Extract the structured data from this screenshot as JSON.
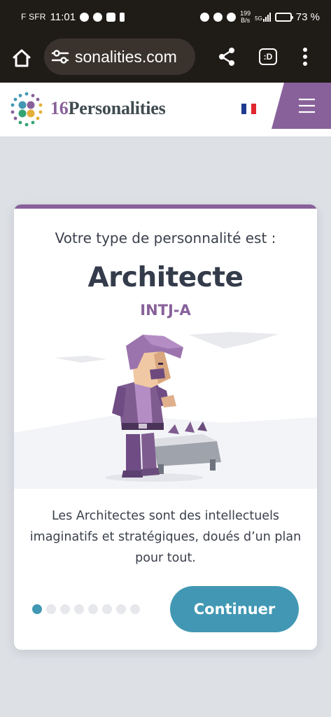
{
  "status_bar": {
    "carrier": "F SFR",
    "time": "11:01",
    "net_speed_value": "199",
    "net_speed_unit": "B/s",
    "network_type": "5G",
    "battery_percent": "73 %",
    "battery_level": 0.73
  },
  "browser": {
    "url": "sonalities.com",
    "extension_label": ":D",
    "icons": [
      "home-icon",
      "tune-icon",
      "share-icon",
      "extension-icon",
      "more-vert-icon"
    ]
  },
  "site": {
    "logo_number": "16",
    "logo_word": "Personalities",
    "language_flag": "french-flag-icon",
    "menu_icon": "hamburger-icon"
  },
  "card": {
    "intro": "Votre type de personnalité est :",
    "title": "Architecte",
    "code": "INTJ-A",
    "description": "Les Architectes sont des intellectuels imaginatifs et stratégiques, doués d’un plan pour tout.",
    "continue_label": "Continuer",
    "pager": {
      "total": 8,
      "current": 1
    }
  },
  "colors": {
    "dark_chrome": "#1f1b17",
    "url_pill": "#3a332d",
    "brand_purple": "#88619a",
    "accent_teal": "#4298b4",
    "page_bg": "#dde0e5",
    "text_dark": "#343c4b"
  }
}
